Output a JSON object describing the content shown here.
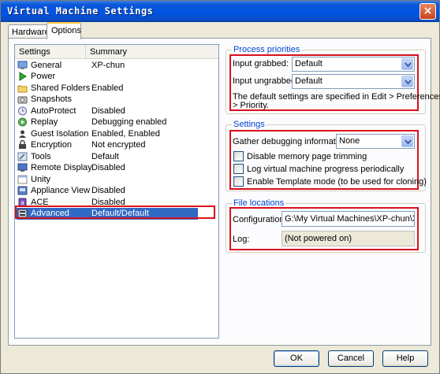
{
  "window": {
    "title": "Virtual Machine Settings",
    "close_glyph": "×"
  },
  "tabs": [
    {
      "label": "Hardware"
    },
    {
      "label": "Options"
    }
  ],
  "settings_list": {
    "columns": {
      "settings": "Settings",
      "summary": "Summary"
    },
    "rows": [
      {
        "name": "General",
        "summary": "XP-chun",
        "icon": "general-icon"
      },
      {
        "name": "Power",
        "summary": "",
        "icon": "power-icon"
      },
      {
        "name": "Shared Folders",
        "summary": "Enabled",
        "icon": "folder-icon"
      },
      {
        "name": "Snapshots",
        "summary": "",
        "icon": "snapshot-icon"
      },
      {
        "name": "AutoProtect",
        "summary": "Disabled",
        "icon": "autoprotect-icon"
      },
      {
        "name": "Replay",
        "summary": "Debugging enabled",
        "icon": "replay-icon"
      },
      {
        "name": "Guest Isolation",
        "summary": "Enabled, Enabled",
        "icon": "guest-isolation-icon"
      },
      {
        "name": "Encryption",
        "summary": "Not encrypted",
        "icon": "encryption-icon"
      },
      {
        "name": "Tools",
        "summary": "Default",
        "icon": "tools-icon"
      },
      {
        "name": "Remote Display",
        "summary": "Disabled",
        "icon": "remote-display-icon"
      },
      {
        "name": "Unity",
        "summary": "",
        "icon": "unity-icon"
      },
      {
        "name": "Appliance View",
        "summary": "Disabled",
        "icon": "appliance-icon"
      },
      {
        "name": "ACE",
        "summary": "Disabled",
        "icon": "ace-icon"
      },
      {
        "name": "Advanced",
        "summary": "Default/Default",
        "icon": "advanced-icon",
        "selected": true
      }
    ]
  },
  "process_priorities": {
    "legend": "Process priorities",
    "input_grabbed_label": "Input grabbed:",
    "input_grabbed_value": "Default",
    "input_ungrabbed_label": "Input ungrabbed:",
    "input_ungrabbed_value": "Default",
    "note_line1": "The default settings are specified in Edit > Preferences",
    "note_line2": "> Priority."
  },
  "settings_group": {
    "legend": "Settings",
    "gather_label": "Gather debugging information:",
    "gather_value": "None",
    "disable_mem_trim": "Disable memory page trimming",
    "log_progress": "Log virtual machine progress periodically",
    "template_mode": "Enable Template mode (to be used for cloning)"
  },
  "file_locations": {
    "legend": "File locations",
    "configuration_label": "Configuration:",
    "configuration_value": "G:\\My Virtual Machines\\XP-chun\\XP-chun",
    "log_label": "Log:",
    "log_value": "(Not powered on)"
  },
  "buttons": {
    "ok": "OK",
    "cancel": "Cancel",
    "help": "Help"
  },
  "colors": {
    "title_bar": "#0054e3",
    "selection": "#316ac5",
    "highlight_box": "#d8101c",
    "group_legend": "#0046d5"
  }
}
